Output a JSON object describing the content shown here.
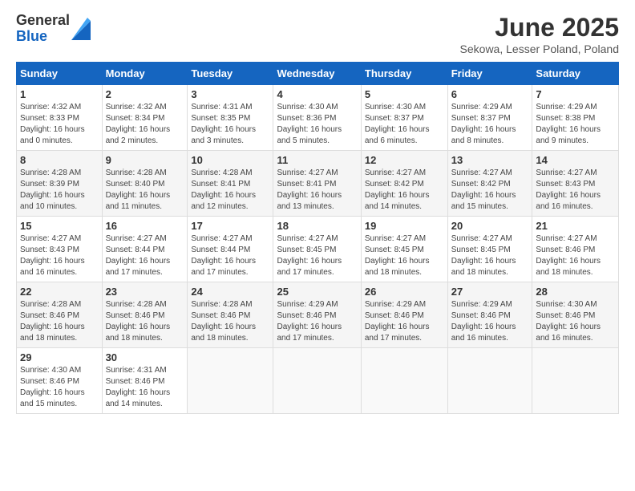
{
  "logo": {
    "general": "General",
    "blue": "Blue"
  },
  "title": "June 2025",
  "subtitle": "Sekowa, Lesser Poland, Poland",
  "days_of_week": [
    "Sunday",
    "Monday",
    "Tuesday",
    "Wednesday",
    "Thursday",
    "Friday",
    "Saturday"
  ],
  "weeks": [
    [
      {
        "day": "1",
        "info": "Sunrise: 4:32 AM\nSunset: 8:33 PM\nDaylight: 16 hours\nand 0 minutes."
      },
      {
        "day": "2",
        "info": "Sunrise: 4:32 AM\nSunset: 8:34 PM\nDaylight: 16 hours\nand 2 minutes."
      },
      {
        "day": "3",
        "info": "Sunrise: 4:31 AM\nSunset: 8:35 PM\nDaylight: 16 hours\nand 3 minutes."
      },
      {
        "day": "4",
        "info": "Sunrise: 4:30 AM\nSunset: 8:36 PM\nDaylight: 16 hours\nand 5 minutes."
      },
      {
        "day": "5",
        "info": "Sunrise: 4:30 AM\nSunset: 8:37 PM\nDaylight: 16 hours\nand 6 minutes."
      },
      {
        "day": "6",
        "info": "Sunrise: 4:29 AM\nSunset: 8:37 PM\nDaylight: 16 hours\nand 8 minutes."
      },
      {
        "day": "7",
        "info": "Sunrise: 4:29 AM\nSunset: 8:38 PM\nDaylight: 16 hours\nand 9 minutes."
      }
    ],
    [
      {
        "day": "8",
        "info": "Sunrise: 4:28 AM\nSunset: 8:39 PM\nDaylight: 16 hours\nand 10 minutes."
      },
      {
        "day": "9",
        "info": "Sunrise: 4:28 AM\nSunset: 8:40 PM\nDaylight: 16 hours\nand 11 minutes."
      },
      {
        "day": "10",
        "info": "Sunrise: 4:28 AM\nSunset: 8:41 PM\nDaylight: 16 hours\nand 12 minutes."
      },
      {
        "day": "11",
        "info": "Sunrise: 4:27 AM\nSunset: 8:41 PM\nDaylight: 16 hours\nand 13 minutes."
      },
      {
        "day": "12",
        "info": "Sunrise: 4:27 AM\nSunset: 8:42 PM\nDaylight: 16 hours\nand 14 minutes."
      },
      {
        "day": "13",
        "info": "Sunrise: 4:27 AM\nSunset: 8:42 PM\nDaylight: 16 hours\nand 15 minutes."
      },
      {
        "day": "14",
        "info": "Sunrise: 4:27 AM\nSunset: 8:43 PM\nDaylight: 16 hours\nand 16 minutes."
      }
    ],
    [
      {
        "day": "15",
        "info": "Sunrise: 4:27 AM\nSunset: 8:43 PM\nDaylight: 16 hours\nand 16 minutes."
      },
      {
        "day": "16",
        "info": "Sunrise: 4:27 AM\nSunset: 8:44 PM\nDaylight: 16 hours\nand 17 minutes."
      },
      {
        "day": "17",
        "info": "Sunrise: 4:27 AM\nSunset: 8:44 PM\nDaylight: 16 hours\nand 17 minutes."
      },
      {
        "day": "18",
        "info": "Sunrise: 4:27 AM\nSunset: 8:45 PM\nDaylight: 16 hours\nand 17 minutes."
      },
      {
        "day": "19",
        "info": "Sunrise: 4:27 AM\nSunset: 8:45 PM\nDaylight: 16 hours\nand 18 minutes."
      },
      {
        "day": "20",
        "info": "Sunrise: 4:27 AM\nSunset: 8:45 PM\nDaylight: 16 hours\nand 18 minutes."
      },
      {
        "day": "21",
        "info": "Sunrise: 4:27 AM\nSunset: 8:46 PM\nDaylight: 16 hours\nand 18 minutes."
      }
    ],
    [
      {
        "day": "22",
        "info": "Sunrise: 4:28 AM\nSunset: 8:46 PM\nDaylight: 16 hours\nand 18 minutes."
      },
      {
        "day": "23",
        "info": "Sunrise: 4:28 AM\nSunset: 8:46 PM\nDaylight: 16 hours\nand 18 minutes."
      },
      {
        "day": "24",
        "info": "Sunrise: 4:28 AM\nSunset: 8:46 PM\nDaylight: 16 hours\nand 18 minutes."
      },
      {
        "day": "25",
        "info": "Sunrise: 4:29 AM\nSunset: 8:46 PM\nDaylight: 16 hours\nand 17 minutes."
      },
      {
        "day": "26",
        "info": "Sunrise: 4:29 AM\nSunset: 8:46 PM\nDaylight: 16 hours\nand 17 minutes."
      },
      {
        "day": "27",
        "info": "Sunrise: 4:29 AM\nSunset: 8:46 PM\nDaylight: 16 hours\nand 16 minutes."
      },
      {
        "day": "28",
        "info": "Sunrise: 4:30 AM\nSunset: 8:46 PM\nDaylight: 16 hours\nand 16 minutes."
      }
    ],
    [
      {
        "day": "29",
        "info": "Sunrise: 4:30 AM\nSunset: 8:46 PM\nDaylight: 16 hours\nand 15 minutes."
      },
      {
        "day": "30",
        "info": "Sunrise: 4:31 AM\nSunset: 8:46 PM\nDaylight: 16 hours\nand 14 minutes."
      },
      {
        "day": "",
        "info": ""
      },
      {
        "day": "",
        "info": ""
      },
      {
        "day": "",
        "info": ""
      },
      {
        "day": "",
        "info": ""
      },
      {
        "day": "",
        "info": ""
      }
    ]
  ]
}
